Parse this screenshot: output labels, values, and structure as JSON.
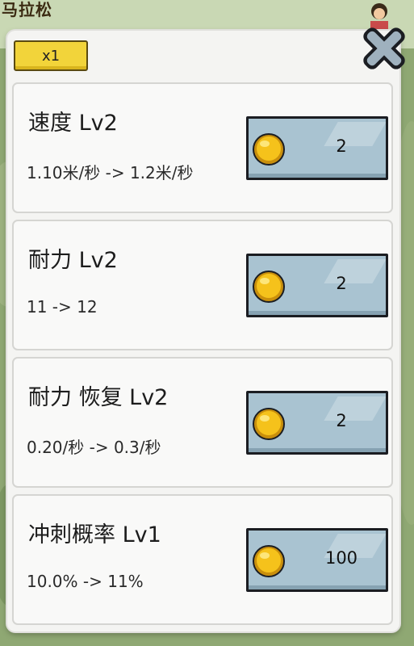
{
  "background": {
    "partial_text": "马拉松"
  },
  "header": {
    "multiplier_label": "x1"
  },
  "upgrades": [
    {
      "title": "速度 Lv2",
      "detail": "1.10米/秒 -> 1.2米/秒",
      "cost": "2"
    },
    {
      "title": "耐力 Lv2",
      "detail": "11 -> 12",
      "cost": "2"
    },
    {
      "title": "耐力 恢复 Lv2",
      "detail": "0.20/秒 -> 0.3/秒",
      "cost": "2"
    },
    {
      "title": "冲刺概率 Lv1",
      "detail": "10.0% -> 11%",
      "cost": "100"
    }
  ],
  "colors": {
    "panel": "#f4f4f2",
    "button": "#a9c3d1",
    "multiplier": "#f2d43a",
    "coin": "#f5c21b"
  },
  "icons": {
    "close": "close-x-icon",
    "coin": "gold-coin-icon"
  }
}
